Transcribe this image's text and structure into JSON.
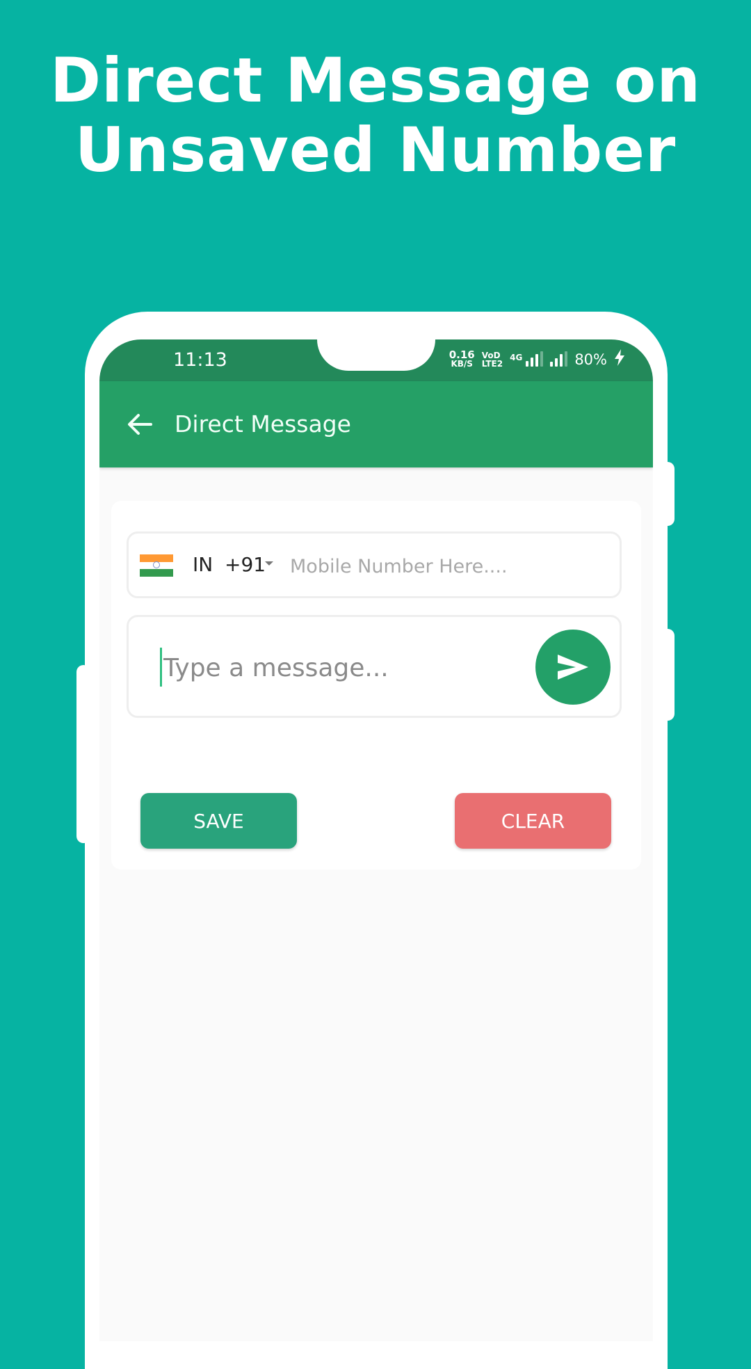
{
  "promo": {
    "headline_line1": "Direct Message on",
    "headline_line2": "Unsaved Number"
  },
  "status_bar": {
    "time": "11:13",
    "net_speed_value": "0.16",
    "net_speed_unit": "KB/S",
    "volte_top": "VoD",
    "volte_bottom": "LTE2",
    "network_type": "4G",
    "battery": "80%",
    "charging_icon": "bolt-icon"
  },
  "app_bar": {
    "back_icon": "arrow-left-icon",
    "title": "Direct Message"
  },
  "form": {
    "country": {
      "flag_icon": "india-flag-icon",
      "iso": "IN",
      "dial_code": "+91"
    },
    "mobile_number": {
      "value": "",
      "placeholder": "Mobile Number Here...."
    },
    "message": {
      "value": "",
      "placeholder": "Type a message..."
    },
    "send_icon": "send-icon",
    "save_label": "SAVE",
    "clear_label": "CLEAR"
  },
  "colors": {
    "background": "#06b3a2",
    "status_bar": "#23895a",
    "app_bar": "#25a066",
    "send_button": "#23a068",
    "save_button": "#29a37c",
    "clear_button": "#e96f71"
  }
}
